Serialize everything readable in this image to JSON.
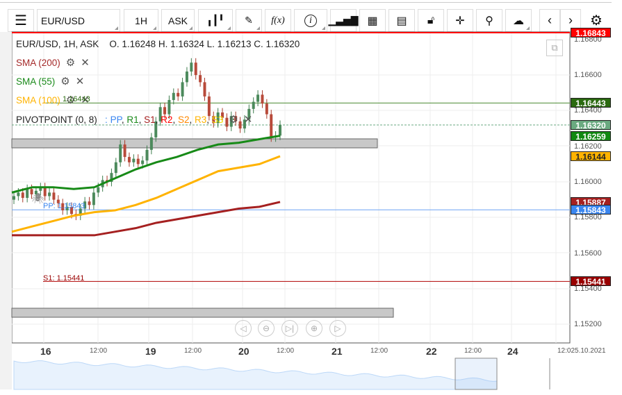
{
  "toolbar": {
    "symbol": "EUR/USD",
    "timeframe": "1H",
    "price_side": "ASK",
    "fx_label": "f(x)",
    "info_label": "i"
  },
  "legend": {
    "title": "EUR/USD, 1H, ASK",
    "ohlc": "O. 1.16248 H. 1.16324 L. 1.16213 C. 1.16320",
    "sma200": "SMA (200)",
    "sma55": "SMA (55)",
    "sma100": "SMA (100)",
    "pivot": "PIVOTPOINT (0, 8)",
    "pivot_sep": ":",
    "pivot_parts": [
      "PP",
      ", ",
      "R1",
      ", ",
      "S1",
      ", ",
      "R2",
      ", ",
      "S2",
      ", ",
      "R3",
      ", ",
      "S3"
    ]
  },
  "lines": {
    "pp_label": "PP: 1.15843",
    "s1_label": "S1: 1.15441",
    "r_label": "1.16443"
  },
  "price_labels": [
    {
      "text": "1.16843",
      "price": 1.16843,
      "color": "#ff0000"
    },
    {
      "text": "1.16443",
      "price": 1.16443,
      "color": "#2b6a10"
    },
    {
      "text": "1.16320",
      "price": 1.1632,
      "color": "#6aaa80"
    },
    {
      "text": "1.16259",
      "price": 1.16259,
      "color": "#118811"
    },
    {
      "text": "1.16144",
      "price": 1.16144,
      "color": "#ffb300"
    },
    {
      "text": "1.15887",
      "price": 1.15887,
      "color": "#a52020"
    },
    {
      "text": "1.15843",
      "price": 1.15843,
      "color": "#3a86f0"
    },
    {
      "text": "1.15441",
      "price": 1.15441,
      "color": "#990000"
    }
  ],
  "y_axis": [
    "1.16800",
    "1.16600",
    "1.16400",
    "1.16200",
    "1.16000",
    "1.15800",
    "1.15600",
    "1.15400",
    "1.15200"
  ],
  "x_axis": {
    "days": [
      "16",
      "19",
      "20",
      "21",
      "22",
      "24"
    ],
    "hours": [
      "12:00",
      "12:00",
      "12:00",
      "12:00",
      "12:00"
    ],
    "last": "12:025.10.2021"
  },
  "chart_data": {
    "type": "candlestick",
    "closes": [
      1.1592,
      1.1594,
      1.1591,
      1.1596,
      1.1593,
      1.1595,
      1.1597,
      1.1592,
      1.1594,
      1.159,
      1.1588,
      1.1584,
      1.1586,
      1.1582,
      1.1581,
      1.1585,
      1.1589,
      1.1587,
      1.1594,
      1.1597,
      1.1601,
      1.16,
      1.1605,
      1.1611,
      1.1621,
      1.1614,
      1.1611,
      1.1613,
      1.161,
      1.1612,
      1.1618,
      1.1625,
      1.1634,
      1.1642,
      1.1638,
      1.1646,
      1.165,
      1.1648,
      1.1656,
      1.1662,
      1.1667,
      1.166,
      1.1656,
      1.1648,
      1.1637,
      1.1633,
      1.1639,
      1.1636,
      1.1631,
      1.1637,
      1.1634,
      1.163,
      1.1635,
      1.1641,
      1.1645,
      1.1649,
      1.1644,
      1.1638,
      1.1625,
      1.1626,
      1.1632
    ],
    "sma55": [
      1.1594,
      1.1597,
      1.1597,
      1.1596,
      1.1597,
      1.1602,
      1.1607,
      1.1611,
      1.1614,
      1.1618,
      1.1621,
      1.1622,
      1.1624,
      1.16259
    ],
    "sma100": [
      1.1572,
      1.1575,
      1.1578,
      1.1581,
      1.1583,
      1.1584,
      1.1587,
      1.1591,
      1.1596,
      1.1601,
      1.1606,
      1.1608,
      1.161,
      1.16144
    ],
    "sma200": [
      1.157,
      1.157,
      1.157,
      1.157,
      1.157,
      1.1572,
      1.1574,
      1.1577,
      1.1579,
      1.1581,
      1.1583,
      1.1585,
      1.1586,
      1.15887
    ]
  }
}
